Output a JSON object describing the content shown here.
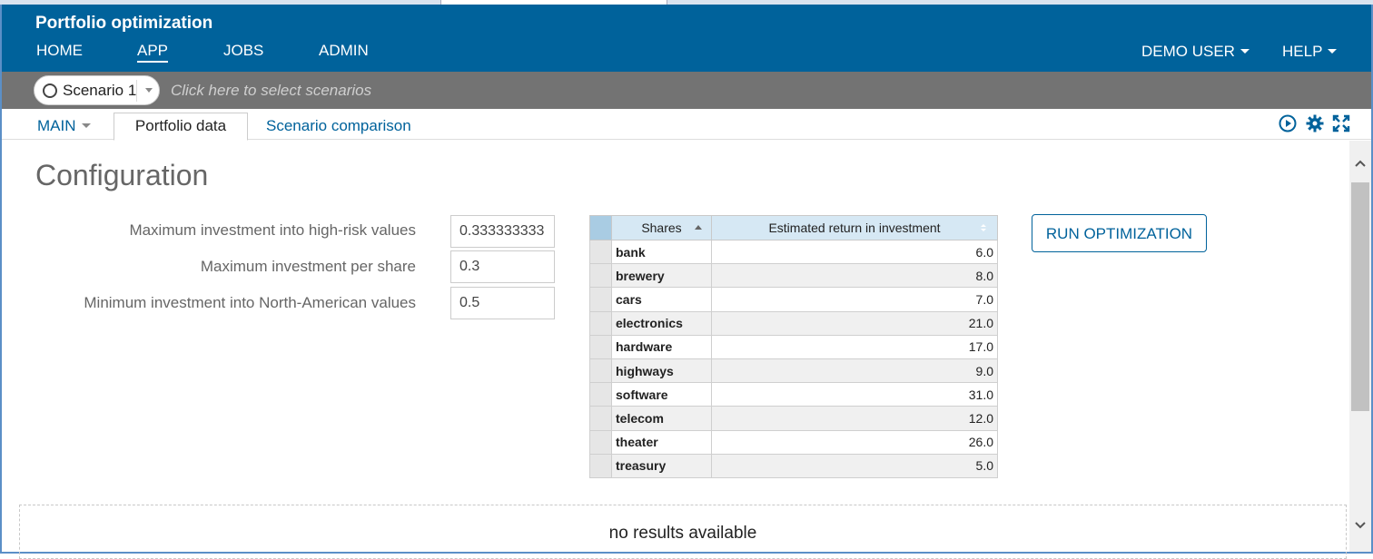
{
  "app": {
    "title": "Portfolio optimization"
  },
  "nav": {
    "items": [
      {
        "label": "HOME"
      },
      {
        "label": "APP"
      },
      {
        "label": "JOBS"
      },
      {
        "label": "ADMIN"
      }
    ],
    "user_menu": "DEMO USER",
    "help_menu": "HELP"
  },
  "scenario": {
    "selected": "Scenario 1",
    "placeholder": "Click here to select scenarios"
  },
  "subtabs": {
    "main_menu": "MAIN",
    "tabs": [
      {
        "label": "Portfolio data"
      },
      {
        "label": "Scenario comparison"
      }
    ]
  },
  "config": {
    "title": "Configuration",
    "params": [
      {
        "label": "Maximum investment into high-risk values",
        "value": "0.333333333"
      },
      {
        "label": "Maximum investment per share",
        "value": "0.3"
      },
      {
        "label": "Minimum investment into North-American values",
        "value": "0.5"
      }
    ]
  },
  "table": {
    "headers": [
      "Shares",
      "Estimated return in investment"
    ],
    "rows": [
      {
        "share": "bank",
        "ret": "6.0"
      },
      {
        "share": "brewery",
        "ret": "8.0"
      },
      {
        "share": "cars",
        "ret": "7.0"
      },
      {
        "share": "electronics",
        "ret": "21.0"
      },
      {
        "share": "hardware",
        "ret": "17.0"
      },
      {
        "share": "highways",
        "ret": "9.0"
      },
      {
        "share": "software",
        "ret": "31.0"
      },
      {
        "share": "telecom",
        "ret": "12.0"
      },
      {
        "share": "theater",
        "ret": "26.0"
      },
      {
        "share": "treasury",
        "ret": "5.0"
      }
    ]
  },
  "run_button": "RUN OPTIMIZATION",
  "results": {
    "text": "no results available"
  },
  "colors": {
    "header": "#00629b",
    "scenario_bar": "#737373",
    "accent": "#00629b"
  },
  "icons": [
    "play-icon",
    "gear-icon",
    "fullscreen-icon"
  ]
}
